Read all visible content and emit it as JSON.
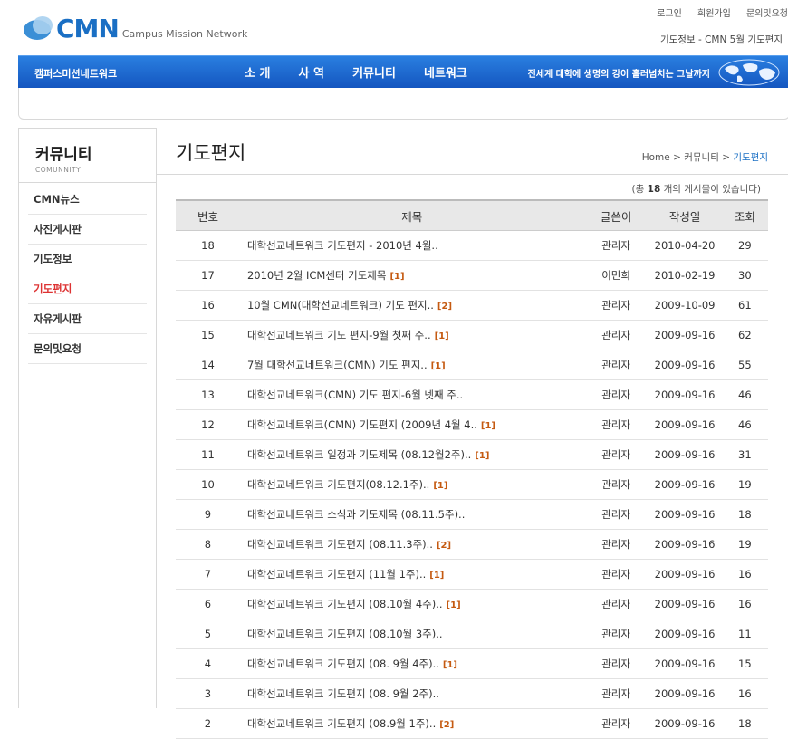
{
  "header": {
    "top_links": [
      "로그인",
      "회원가입",
      "문의및요청"
    ],
    "logo_text": "CMN",
    "logo_sub": "Campus Mission Network",
    "page_caption": "기도정보 - CMN 5월 기도편지"
  },
  "nav": {
    "brand": "캠퍼스미션네트워크",
    "items": [
      "소 개",
      "사 역",
      "커뮤니티",
      "네트워크"
    ],
    "slogan": "전세계 대학에 생명의 강이 흘러넘치는 그날까지"
  },
  "sidebar": {
    "title": "커뮤니티",
    "subtitle": "COMUNNITY",
    "items": [
      {
        "label": "CMN뉴스"
      },
      {
        "label": "사진게시판"
      },
      {
        "label": "기도정보"
      },
      {
        "label": "기도편지"
      },
      {
        "label": "자유게시판"
      },
      {
        "label": "문의및요청"
      }
    ],
    "active_index": 3
  },
  "main": {
    "title": "기도편지",
    "breadcrumb": {
      "home": "Home",
      "sep1": " > ",
      "section": "커뮤니티",
      "sep2": " > ",
      "current": "기도편지"
    },
    "count": {
      "prefix": "(총 ",
      "value": "18",
      "suffix": " 개의 게시물이 있습니다)"
    },
    "columns": [
      "번호",
      "제목",
      "글쓴이",
      "작성일",
      "조회"
    ],
    "rows": [
      {
        "no": "18",
        "title": "대학선교네트워크 기도편지 - 2010년 4월..",
        "comments": "",
        "writer": "관리자",
        "date": "2010-04-20",
        "hits": "29"
      },
      {
        "no": "17",
        "title": "2010년 2월 ICM센터 기도제목",
        "comments": "[1]",
        "writer": "이민희",
        "date": "2010-02-19",
        "hits": "30"
      },
      {
        "no": "16",
        "title": "10월 CMN(대학선교네트워크) 기도 편지..",
        "comments": "[2]",
        "writer": "관리자",
        "date": "2009-10-09",
        "hits": "61"
      },
      {
        "no": "15",
        "title": "대학선교네트워크 기도 편지-9월 첫째 주..",
        "comments": "[1]",
        "writer": "관리자",
        "date": "2009-09-16",
        "hits": "62"
      },
      {
        "no": "14",
        "title": "7월 대학선교네트워크(CMN) 기도 편지..",
        "comments": "[1]",
        "writer": "관리자",
        "date": "2009-09-16",
        "hits": "55"
      },
      {
        "no": "13",
        "title": "대학선교네트워크(CMN) 기도 편지-6월 넷째 주..",
        "comments": "",
        "writer": "관리자",
        "date": "2009-09-16",
        "hits": "46"
      },
      {
        "no": "12",
        "title": "대학선교네트워크(CMN) 기도편지 (2009년 4월 4..",
        "comments": "[1]",
        "writer": "관리자",
        "date": "2009-09-16",
        "hits": "46"
      },
      {
        "no": "11",
        "title": "대학선교네트워크 일정과 기도제목 (08.12월2주)..",
        "comments": "[1]",
        "writer": "관리자",
        "date": "2009-09-16",
        "hits": "31"
      },
      {
        "no": "10",
        "title": "대학선교네트워크 기도편지(08.12.1주)..",
        "comments": "[1]",
        "writer": "관리자",
        "date": "2009-09-16",
        "hits": "19"
      },
      {
        "no": "9",
        "title": "대학선교네트워크 소식과 기도제목 (08.11.5주)..",
        "comments": "",
        "writer": "관리자",
        "date": "2009-09-16",
        "hits": "18"
      },
      {
        "no": "8",
        "title": "대학선교네트워크 기도편지 (08.11.3주)..",
        "comments": "[2]",
        "writer": "관리자",
        "date": "2009-09-16",
        "hits": "19"
      },
      {
        "no": "7",
        "title": "대학선교네트워크 기도편지 (11월 1주)..",
        "comments": "[1]",
        "writer": "관리자",
        "date": "2009-09-16",
        "hits": "16"
      },
      {
        "no": "6",
        "title": "대학선교네트워크 기도편지 (08.10월 4주)..",
        "comments": "[1]",
        "writer": "관리자",
        "date": "2009-09-16",
        "hits": "16"
      },
      {
        "no": "5",
        "title": "대학선교네트워크 기도편지 (08.10월 3주)..",
        "comments": "",
        "writer": "관리자",
        "date": "2009-09-16",
        "hits": "11"
      },
      {
        "no": "4",
        "title": "대학선교네트워크 기도편지 (08. 9월 4주)..",
        "comments": "[1]",
        "writer": "관리자",
        "date": "2009-09-16",
        "hits": "15"
      },
      {
        "no": "3",
        "title": "대학선교네트워크 기도편지 (08. 9월 2주)..",
        "comments": "",
        "writer": "관리자",
        "date": "2009-09-16",
        "hits": "16"
      },
      {
        "no": "2",
        "title": "대학선교네트워크 기도편지 (08.9월 1주)..",
        "comments": "[2]",
        "writer": "관리자",
        "date": "2009-09-16",
        "hits": "18"
      }
    ]
  }
}
